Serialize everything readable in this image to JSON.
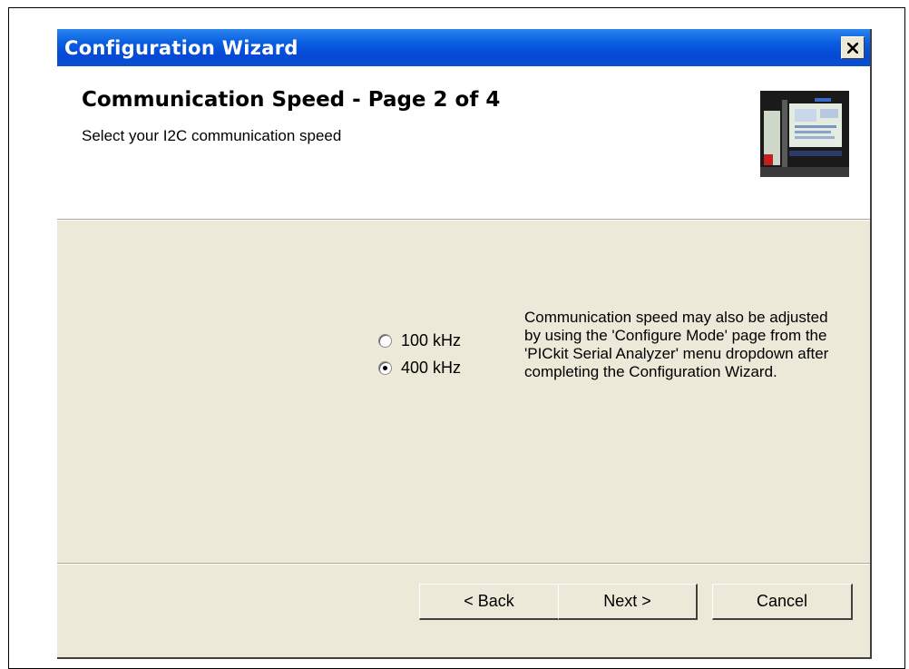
{
  "window": {
    "title": "Configuration Wizard",
    "close_glyph": "×"
  },
  "header": {
    "title": "Communication Speed  -  Page 2 of 4",
    "subtitle": "Select your I2C communication speed",
    "image_icon": "wizard-banner-icon"
  },
  "speed": {
    "options": [
      {
        "label": "100 kHz",
        "selected": false
      },
      {
        "label": "400 kHz",
        "selected": true
      }
    ],
    "info": "Communication speed may also be adjusted by using the 'Configure Mode' page from the 'PICkit Serial Analyzer' menu dropdown after completing the Configuration Wizard."
  },
  "buttons": {
    "back": "< Back",
    "next": "Next >",
    "cancel": "Cancel"
  },
  "colors": {
    "titlebar": "#0a5fe0",
    "dialog_bg": "#ece9d8"
  }
}
